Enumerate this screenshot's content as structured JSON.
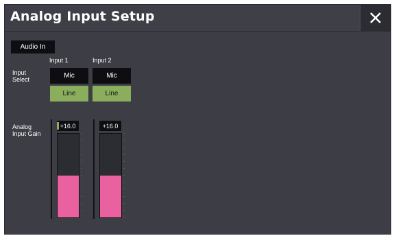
{
  "window": {
    "title": "Analog Input Setup",
    "close_icon": "close-x-icon"
  },
  "tab": {
    "label": "Audio In"
  },
  "input_select": {
    "label_line1": "Input",
    "label_line2": "Select",
    "options": [
      "Mic",
      "Line"
    ]
  },
  "inputs": [
    {
      "name": "Input 1",
      "selected": "Line",
      "gain_text": "+16.0",
      "gain_fraction": 0.5
    },
    {
      "name": "Input 2",
      "selected": "Line",
      "gain_text": "+16.0",
      "gain_fraction": 0.5
    }
  ],
  "gain": {
    "label_line1": "Analog",
    "label_line2": "Input Gain"
  },
  "colors": {
    "background": "#3d3d45",
    "selected_button": "#8aae5c",
    "gain_fill": "#ea619f"
  }
}
